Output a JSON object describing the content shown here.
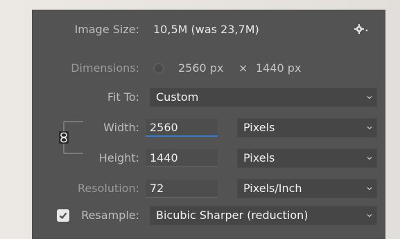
{
  "image_size": {
    "label": "Image Size:",
    "value": "10,5M (was 23,7M)"
  },
  "dimensions": {
    "label": "Dimensions:",
    "width": "2560 px",
    "times": "×",
    "height": "1440 px"
  },
  "fit_to": {
    "label": "Fit To:",
    "selected": "Custom"
  },
  "width": {
    "label": "Width:",
    "value": "2560",
    "unit": "Pixels"
  },
  "height": {
    "label": "Height:",
    "value": "1440",
    "unit": "Pixels"
  },
  "resolution": {
    "label": "Resolution:",
    "value": "72",
    "unit": "Pixels/Inch"
  },
  "resample": {
    "label": "Resample:",
    "checked": true,
    "method": "Bicubic Sharper (reduction)"
  },
  "icons": {
    "settings": "gear-icon",
    "constrain": "chain-link-icon",
    "dropdown": "chevron-down-icon",
    "checkmark": "checkmark-icon"
  },
  "colors": {
    "panel": "#535353",
    "field": "#464646",
    "accent_focus": "#2f7bd6",
    "text": "#e8e8e8",
    "label": "#bdbdbd"
  }
}
